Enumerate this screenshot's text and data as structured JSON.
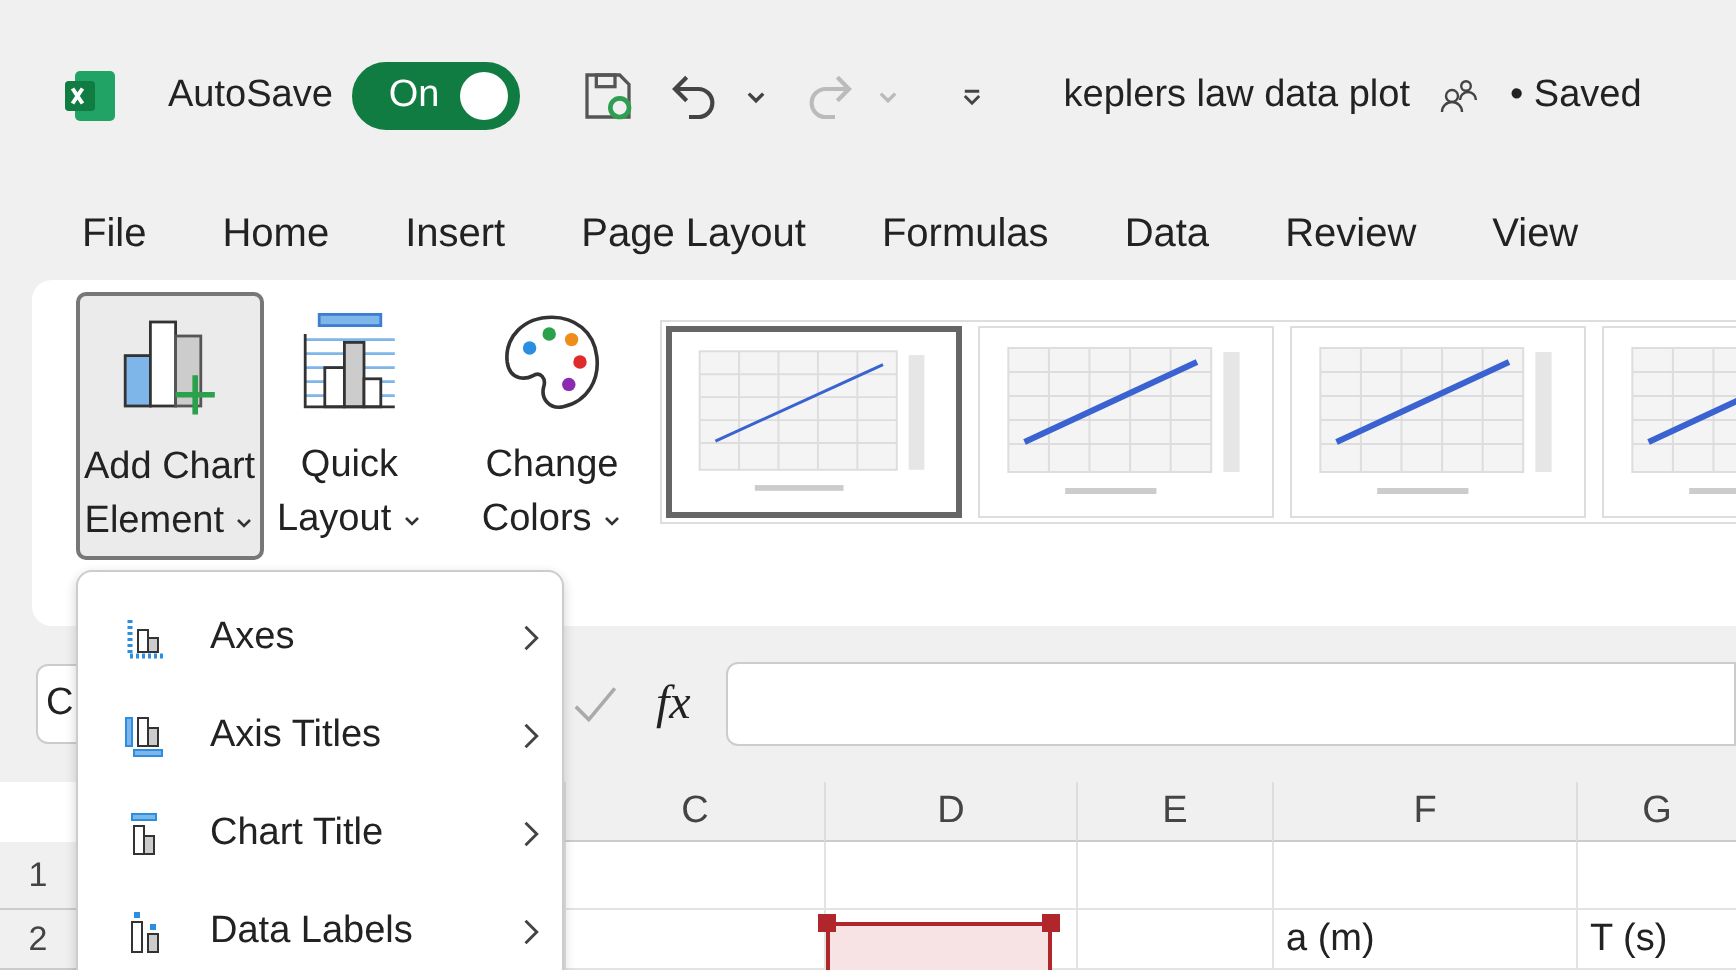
{
  "title_bar": {
    "autosave_label": "AutoSave",
    "autosave": {
      "on": true,
      "label": "On"
    },
    "document_title": "keplers law data plot",
    "save_status": "• Saved"
  },
  "tabs": [
    {
      "label": "File",
      "selected": false
    },
    {
      "label": "Home",
      "selected": false
    },
    {
      "label": "Insert",
      "selected": false
    },
    {
      "label": "Page Layout",
      "selected": false
    },
    {
      "label": "Formulas",
      "selected": false
    },
    {
      "label": "Data",
      "selected": false
    },
    {
      "label": "Review",
      "selected": false
    },
    {
      "label": "View",
      "selected": false
    }
  ],
  "ribbon": {
    "buttons": [
      {
        "kind": "add-element",
        "line1": "Add Chart",
        "line2": "Element",
        "pressed": true
      },
      {
        "kind": "quick-layout",
        "line1": "Quick",
        "line2": "Layout",
        "pressed": false
      }
    ],
    "change_colors": {
      "line1": "Change",
      "line2": "Colors"
    },
    "chart_styles": [
      {
        "selected": true,
        "kind": "picture"
      },
      {
        "selected": false,
        "kind": "picture"
      },
      {
        "selected": false,
        "kind": "picture"
      },
      {
        "selected": false,
        "kind": "picture"
      }
    ]
  },
  "formula_bar": {
    "name_box": "C",
    "fx": "fx"
  },
  "sheet": {
    "columns": [
      "C",
      "D",
      "E",
      "F",
      "G"
    ],
    "rows": [
      {
        "number": "1",
        "cells": [
          "",
          "",
          "",
          "",
          ""
        ]
      },
      {
        "number": "2",
        "cells": [
          "",
          "",
          "",
          "a (m)",
          "T (s)"
        ]
      }
    ]
  },
  "menu": {
    "items": [
      {
        "kind": "axes",
        "label": "Axes"
      },
      {
        "kind": "axis-titles",
        "label": "Axis Titles"
      },
      {
        "kind": "chart-title",
        "label": "Chart Title"
      },
      {
        "kind": "data-labels",
        "label": "Data Labels"
      }
    ]
  }
}
